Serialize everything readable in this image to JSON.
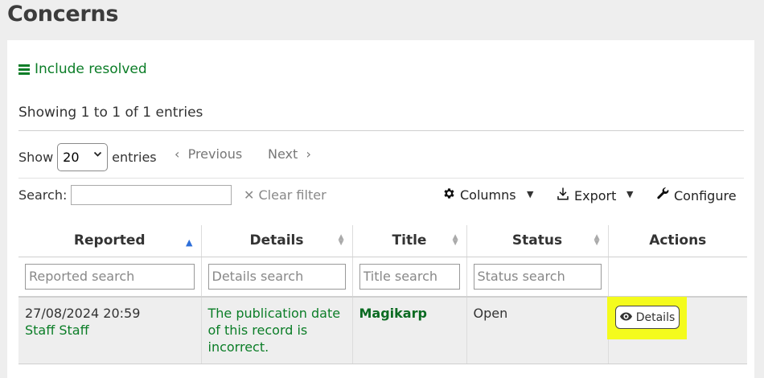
{
  "page": {
    "title": "Concerns"
  },
  "filters": {
    "include_resolved_label": "Include resolved"
  },
  "table_info": "Showing 1 to 1 of 1 entries",
  "length": {
    "show_label": "Show",
    "selected": "20",
    "entries_label": "entries"
  },
  "pager": {
    "previous": "Previous",
    "next": "Next"
  },
  "search": {
    "label": "Search:",
    "value": "",
    "clear_label": "Clear filter"
  },
  "toolbar": {
    "columns": "Columns",
    "export": "Export",
    "configure": "Configure"
  },
  "columns": [
    "Reported",
    "Details",
    "Title",
    "Status",
    "Actions"
  ],
  "column_filters": {
    "reported_placeholder": "Reported search",
    "details_placeholder": "Details search",
    "title_placeholder": "Title search",
    "status_placeholder": "Status search"
  },
  "rows": [
    {
      "reported_date": "27/08/2024 20:59",
      "reported_by": "Staff Staff",
      "details": "The publication date of this record is incorrect.",
      "title": "Magikarp",
      "status": "Open",
      "action_label": "Details"
    }
  ],
  "colors": {
    "link": "#0b7d27",
    "highlight": "#f4fb1d",
    "sort_active": "#2e6fd9"
  }
}
